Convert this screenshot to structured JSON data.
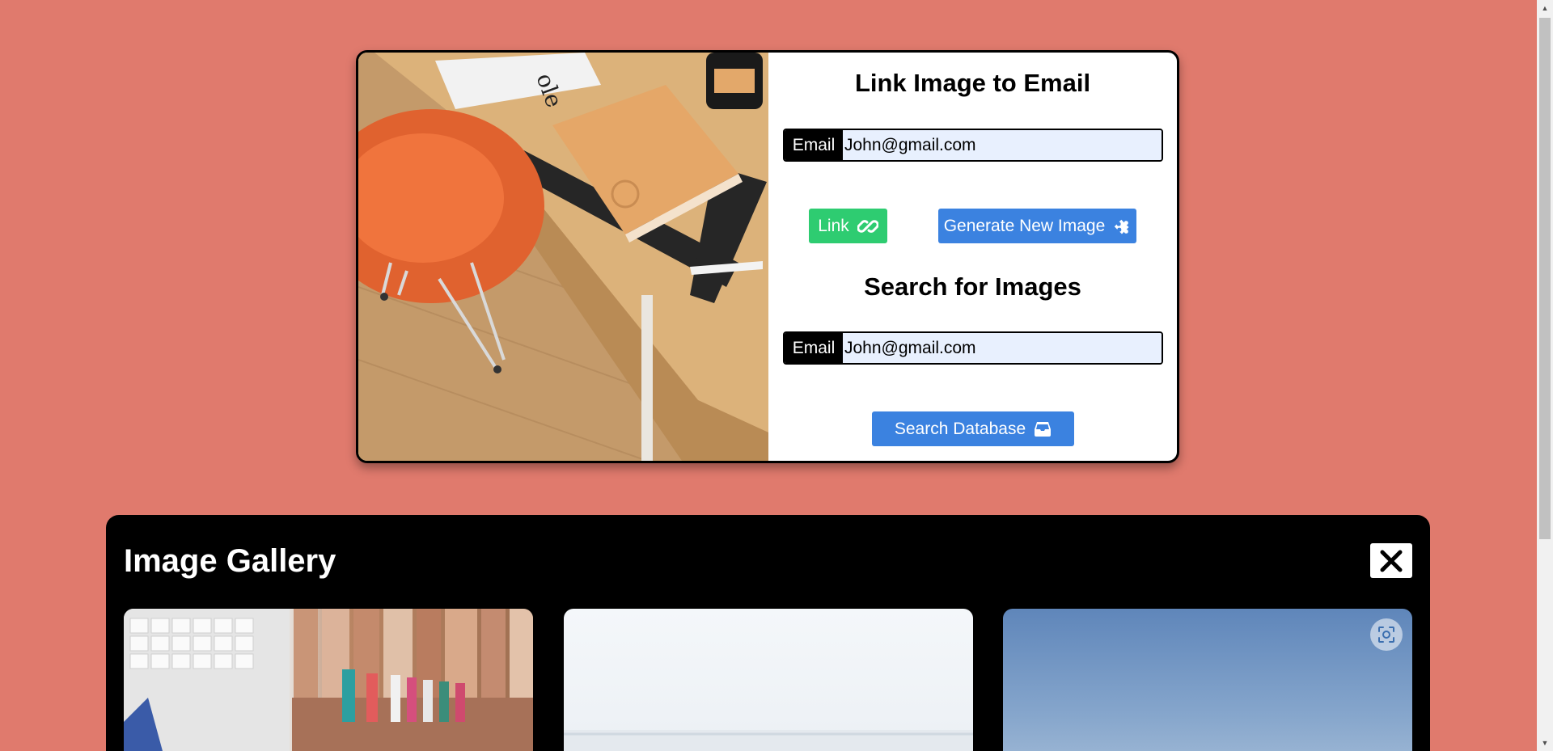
{
  "link_section": {
    "title": "Link Image to Email",
    "email_label": "Email",
    "email_value": "John@gmail.com",
    "link_button": "Link",
    "generate_button": "Generate New Image"
  },
  "search_section": {
    "title": "Search for Images",
    "email_label": "Email",
    "email_value": "John@gmail.com",
    "search_button": "Search Database"
  },
  "gallery": {
    "title": "Image Gallery"
  },
  "colors": {
    "background": "#e07a6d",
    "link_button": "#2ecc71",
    "primary_button": "#3b82e0"
  },
  "icons": {
    "link_button": "link-icon",
    "generate_button": "puzzle-piece-icon",
    "search_button": "inbox-icon",
    "gallery_close": "close-icon",
    "thumbnail_action": "lens-icon"
  }
}
